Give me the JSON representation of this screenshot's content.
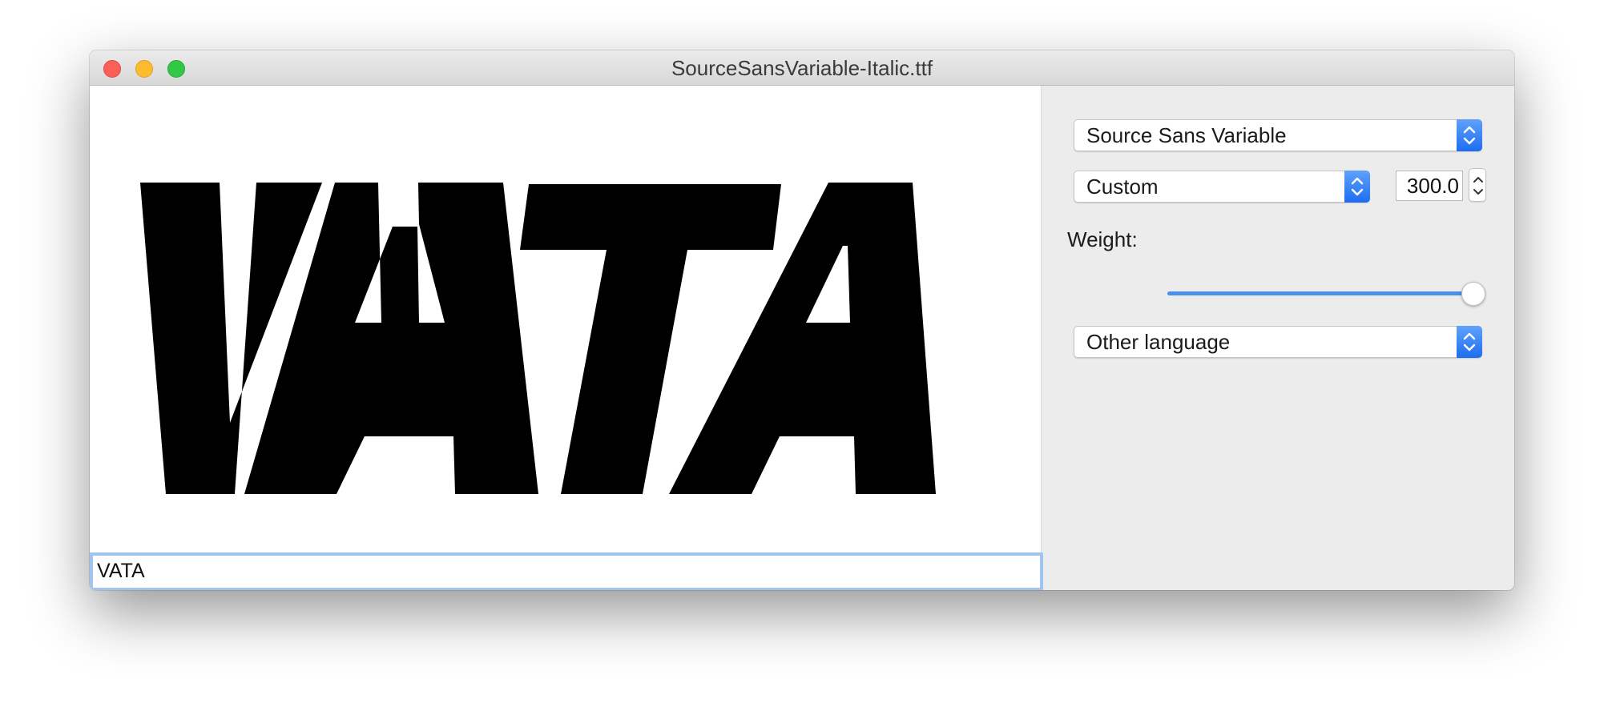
{
  "window": {
    "title": "SourceSansVariable-Italic.ttf"
  },
  "preview": {
    "sample_text": "VATA",
    "glyph_color": "#000000"
  },
  "text_field": {
    "value": "VATA"
  },
  "controls": {
    "font_popup": {
      "selected": "Source Sans Variable"
    },
    "instance_popup": {
      "selected": "Custom"
    },
    "size_field": {
      "value": "300.0"
    },
    "weight": {
      "label": "Weight:",
      "level_fraction": 1.0
    },
    "language_popup": {
      "selected": "Other language"
    }
  },
  "colors": {
    "accent": "#3b82f6",
    "close": "#fc5f57",
    "minimize": "#fdbc2e",
    "maximize": "#33c748"
  },
  "icons": {
    "popup_arrows": "chevron-up-down-icon",
    "stepper": "stepper-up-down-icon"
  }
}
